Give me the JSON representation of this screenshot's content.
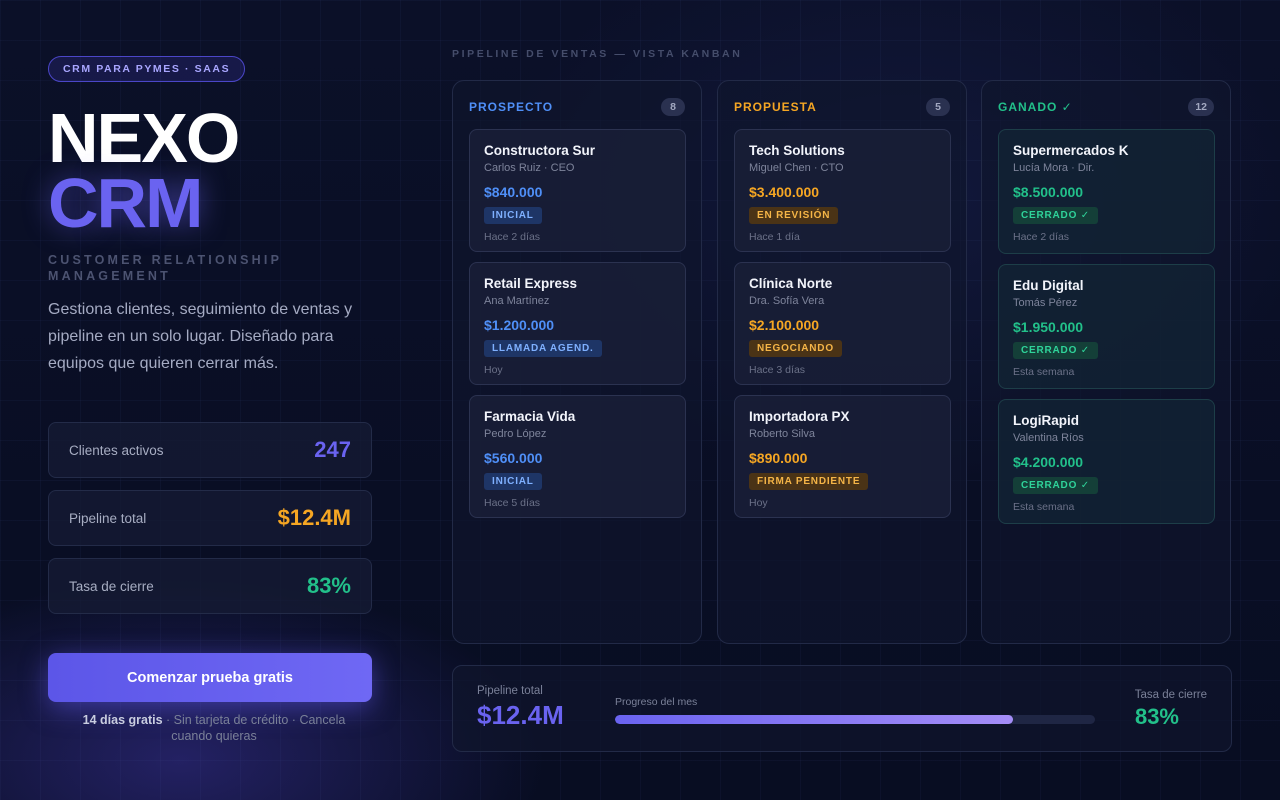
{
  "hero": {
    "tag": "CRM PARA PYMES · SAAS",
    "brand_line1": "NEXO",
    "brand_line2": "CRM",
    "subtitle": "CUSTOMER RELATIONSHIP MANAGEMENT",
    "description": "Gestiona clientes, seguimiento de ventas y pipeline en un solo lugar. Diseñado para equipos que quieren cerrar más."
  },
  "stats": [
    {
      "label": "Clientes activos",
      "value": "247",
      "color": "#6a63f0"
    },
    {
      "label": "Pipeline total",
      "value": "$12.4M",
      "color": "#f5a623"
    },
    {
      "label": "Tasa de cierre",
      "value": "83%",
      "color": "#22c08a"
    }
  ],
  "cta": {
    "label": "Comenzar prueba gratis",
    "fine_bold": "14 días gratis",
    "fine_rest": " · Sin tarjeta de crédito · Cancela cuando quieras"
  },
  "kanban": {
    "section_label": "PIPELINE DE VENTAS — VISTA KANBAN",
    "columns": [
      {
        "title": "PROSPECTO",
        "count": "8",
        "color": "#4f8ff7",
        "badge_bg": "#1e3566",
        "badge_fg": "#7fb0ff",
        "cards": [
          {
            "name": "Constructora Sur",
            "contact": "Carlos Ruiz · CEO",
            "amount": "$840.000",
            "badge": "INICIAL",
            "time": "Hace 2 días"
          },
          {
            "name": "Retail Express",
            "contact": "Ana Martínez",
            "amount": "$1.200.000",
            "badge": "LLAMADA AGEND.",
            "time": "Hoy"
          },
          {
            "name": "Farmacia Vida",
            "contact": "Pedro López",
            "amount": "$560.000",
            "badge": "INICIAL",
            "time": "Hace 5 días"
          }
        ]
      },
      {
        "title": "PROPUESTA",
        "count": "5",
        "color": "#f5a623",
        "badge_bg": "#4a3316",
        "badge_fg": "#f5b547",
        "cards": [
          {
            "name": "Tech Solutions",
            "contact": "Miguel Chen · CTO",
            "amount": "$3.400.000",
            "badge": "EN REVISIÓN",
            "time": "Hace 1 día"
          },
          {
            "name": "Clínica Norte",
            "contact": "Dra. Sofía Vera",
            "amount": "$2.100.000",
            "badge": "NEGOCIANDO",
            "time": "Hace 3 días"
          },
          {
            "name": "Importadora PX",
            "contact": "Roberto Silva",
            "amount": "$890.000",
            "badge": "FIRMA PENDIENTE",
            "time": "Hoy"
          }
        ]
      },
      {
        "title": "GANADO ✓",
        "count": "12",
        "color": "#22c08a",
        "badge_bg": "#143f38",
        "badge_fg": "#2fd39a",
        "cards": [
          {
            "name": "Supermercados K",
            "contact": "Lucía Mora · Dir.",
            "amount": "$8.500.000",
            "badge": "CERRADO ✓",
            "time": "Hace 2 días"
          },
          {
            "name": "Edu Digital",
            "contact": "Tomás Pérez",
            "amount": "$1.950.000",
            "badge": "CERRADO ✓",
            "time": "Esta semana"
          },
          {
            "name": "LogiRapid",
            "contact": "Valentina Ríos",
            "amount": "$4.200.000",
            "badge": "CERRADO ✓",
            "time": "Esta semana"
          }
        ]
      }
    ]
  },
  "summary": {
    "pipeline_label": "Pipeline total",
    "pipeline_value": "$12.4M",
    "progress_label": "Progreso del mes",
    "progress_percent": 83,
    "close_label": "Tasa de cierre",
    "close_value": "83%"
  }
}
